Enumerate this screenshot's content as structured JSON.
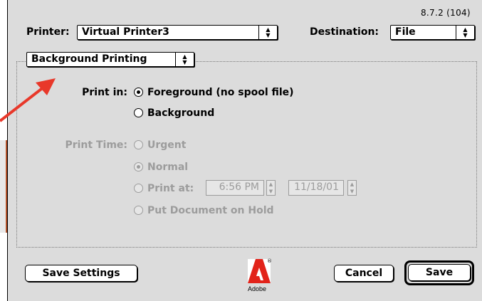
{
  "version": "8.7.2 (104)",
  "printer": {
    "label": "Printer:",
    "value": "Virtual Printer3"
  },
  "destination": {
    "label": "Destination:",
    "value": "File"
  },
  "panel_popup": {
    "value": "Background Printing"
  },
  "print_in": {
    "label": "Print in:",
    "options": [
      {
        "label": "Foreground (no spool file)",
        "selected": true
      },
      {
        "label": "Background",
        "selected": false
      }
    ]
  },
  "print_time": {
    "label": "Print Time:",
    "enabled": false,
    "options": [
      {
        "label": "Urgent",
        "selected": false
      },
      {
        "label": "Normal",
        "selected": true
      },
      {
        "label": "Print at:",
        "selected": false
      },
      {
        "label": "Put Document on Hold",
        "selected": false
      }
    ],
    "time_value": "6:56 PM",
    "date_value": "11/18/01"
  },
  "buttons": {
    "save_settings": "Save Settings",
    "cancel": "Cancel",
    "save": "Save"
  },
  "logo": {
    "brand": "Adobe",
    "mark": "®"
  },
  "colors": {
    "dialog_bg": "#dcdcdc",
    "disabled_text": "#9c9c9c",
    "annotation_arrow": "#e8382a"
  },
  "icons": {
    "popup_arrows": "up-down-arrows-icon",
    "stepper": "stepper-icon",
    "annotation": "red-arrow-icon"
  }
}
